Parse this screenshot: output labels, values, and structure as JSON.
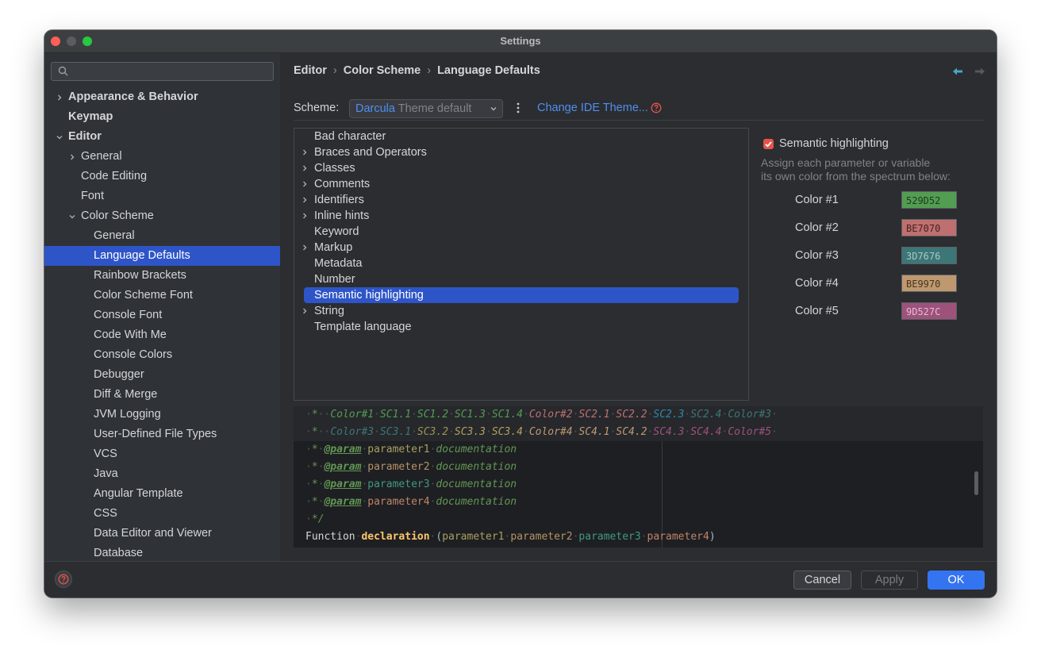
{
  "window": {
    "title": "Settings"
  },
  "sidebar": {
    "search_placeholder": "",
    "items": [
      {
        "label": "Appearance & Behavior",
        "level": 0,
        "bold": true,
        "chevron": "right"
      },
      {
        "label": "Keymap",
        "level": 0,
        "bold": true,
        "chevron": "none"
      },
      {
        "label": "Editor",
        "level": 0,
        "bold": true,
        "chevron": "down"
      },
      {
        "label": "General",
        "level": 1,
        "chevron": "right"
      },
      {
        "label": "Code Editing",
        "level": 1,
        "chevron": "none"
      },
      {
        "label": "Font",
        "level": 1,
        "chevron": "none"
      },
      {
        "label": "Color Scheme",
        "level": 1,
        "chevron": "down"
      },
      {
        "label": "General",
        "level": 2
      },
      {
        "label": "Language Defaults",
        "level": 2,
        "selected": true
      },
      {
        "label": "Rainbow Brackets",
        "level": 2
      },
      {
        "label": "Color Scheme Font",
        "level": 2
      },
      {
        "label": "Console Font",
        "level": 2
      },
      {
        "label": "Code With Me",
        "level": 2
      },
      {
        "label": "Console Colors",
        "level": 2
      },
      {
        "label": "Debugger",
        "level": 2
      },
      {
        "label": "Diff & Merge",
        "level": 2
      },
      {
        "label": "JVM Logging",
        "level": 2
      },
      {
        "label": "User-Defined File Types",
        "level": 2
      },
      {
        "label": "VCS",
        "level": 2
      },
      {
        "label": "Java",
        "level": 2
      },
      {
        "label": "Angular Template",
        "level": 2
      },
      {
        "label": "CSS",
        "level": 2
      },
      {
        "label": "Data Editor and Viewer",
        "level": 2
      },
      {
        "label": "Database",
        "level": 2
      }
    ]
  },
  "breadcrumb": {
    "a": "Editor",
    "b": "Color Scheme",
    "c": "Language Defaults",
    "sep": "›"
  },
  "scheme": {
    "label": "Scheme:",
    "name": "Darcula",
    "suffix": "Theme default",
    "change_theme": "Change IDE Theme..."
  },
  "elements": [
    {
      "label": "Bad character",
      "chevron": false
    },
    {
      "label": "Braces and Operators",
      "chevron": true
    },
    {
      "label": "Classes",
      "chevron": true
    },
    {
      "label": "Comments",
      "chevron": true
    },
    {
      "label": "Identifiers",
      "chevron": true
    },
    {
      "label": "Inline hints",
      "chevron": true
    },
    {
      "label": "Keyword",
      "chevron": false
    },
    {
      "label": "Markup",
      "chevron": true
    },
    {
      "label": "Metadata",
      "chevron": false
    },
    {
      "label": "Number",
      "chevron": false
    },
    {
      "label": "Semantic highlighting",
      "chevron": false,
      "selected": true
    },
    {
      "label": "String",
      "chevron": true
    },
    {
      "label": "Template language",
      "chevron": false
    }
  ],
  "semantic": {
    "checkbox_label": "Semantic highlighting",
    "checked": true,
    "desc1": "Assign each parameter or variable",
    "desc2": "its own color from the spectrum below:",
    "colors": [
      {
        "label": "Color #1",
        "hex": "529D52",
        "bg": "#529d52",
        "fg": "#1d3a1d"
      },
      {
        "label": "Color #2",
        "hex": "BE7070",
        "bg": "#be7070",
        "fg": "#4a2020"
      },
      {
        "label": "Color #3",
        "hex": "3D7676",
        "bg": "#3d7676",
        "fg": "#a8c8c8"
      },
      {
        "label": "Color #4",
        "hex": "BE9970",
        "bg": "#be9970",
        "fg": "#4a3520"
      },
      {
        "label": "Color #5",
        "hex": "9D527C",
        "bg": "#9d527c",
        "fg": "#e6bcd4"
      }
    ]
  },
  "preview": {
    "l1": [
      "*",
      "Color#1",
      "SC1.1",
      "SC1.2",
      "SC1.3",
      "SC1.4",
      "Color#2",
      "SC2.1",
      "SC2.2",
      "SC2.3",
      "SC2.4",
      "Color#3"
    ],
    "l2": [
      "*",
      "Color#3",
      "SC3.1",
      "SC3.2",
      "SC3.3",
      "SC3.4",
      "Color#4",
      "SC4.1",
      "SC4.2",
      "SC4.3",
      "SC4.4",
      "Color#5"
    ],
    "params": [
      {
        "tag": "@param",
        "name": "parameter1",
        "doc": "documentation"
      },
      {
        "tag": "@param",
        "name": "parameter2",
        "doc": "documentation"
      },
      {
        "tag": "@param",
        "name": "parameter3",
        "doc": "documentation"
      },
      {
        "tag": "@param",
        "name": "parameter4",
        "doc": "documentation"
      }
    ],
    "close": "*/",
    "fn_kw": "Function",
    "fn_name": "declaration",
    "args": [
      "parameter1",
      "parameter2",
      "parameter3",
      "parameter4"
    ]
  },
  "footer": {
    "cancel": "Cancel",
    "apply": "Apply",
    "ok": "OK"
  }
}
